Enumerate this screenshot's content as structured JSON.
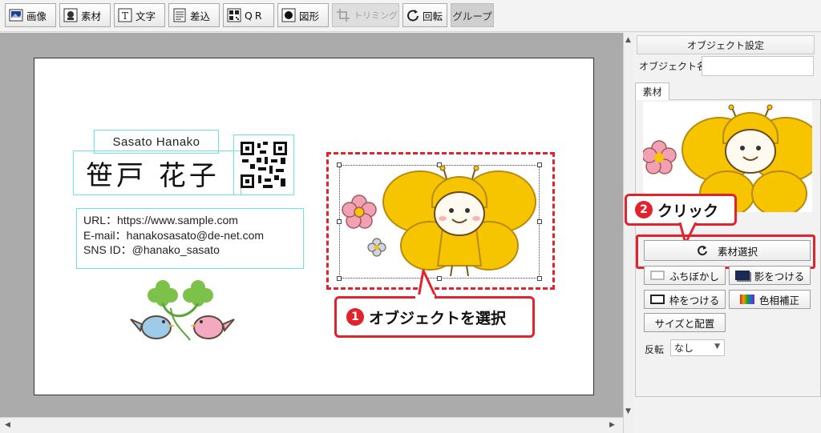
{
  "toolbar": {
    "items": [
      {
        "label": "画像",
        "icon": "image-icon"
      },
      {
        "label": "素材",
        "icon": "material-icon"
      },
      {
        "label": "文字",
        "icon": "text-icon"
      },
      {
        "label": "差込",
        "icon": "merge-icon"
      },
      {
        "label": "QR",
        "icon": "qr-icon"
      },
      {
        "label": "図形",
        "icon": "shape-icon"
      },
      {
        "label": "トリミング",
        "icon": "crop-icon",
        "disabled": true
      },
      {
        "label": "回転",
        "icon": "rotate-icon"
      },
      {
        "label": "グループ",
        "icon": "",
        "disabled": true
      }
    ]
  },
  "card": {
    "name_roman": "Sasato Hanako",
    "name_jp": "笹戸 花子",
    "info": {
      "url": "URL：https://www.sample.com",
      "email": "E-mail：hanakosasato@de-net.com",
      "sns": "SNS ID：@hanako_sasato"
    }
  },
  "callouts": {
    "step1_number": "1",
    "step1_text": "オブジェクトを選択",
    "step2_number": "2",
    "step2_text": "クリック"
  },
  "panel": {
    "title": "オブジェクト設定",
    "object_name_label": "オブジェクト名",
    "object_name_value": "",
    "tab_label": "素材",
    "select_material_button": "素材選択",
    "blur_border_button": "ふちぼかし",
    "shadow_button": "影をつける",
    "frame_button": "枠をつける",
    "color_correct_button": "色相補正",
    "size_position_button": "サイズと配置",
    "flip_label": "反転",
    "flip_value": "なし"
  },
  "colors": {
    "accent_red": "#e0232c",
    "selection_cyan": "#6fe1e8",
    "butterfly_yellow": "#f7c400"
  }
}
